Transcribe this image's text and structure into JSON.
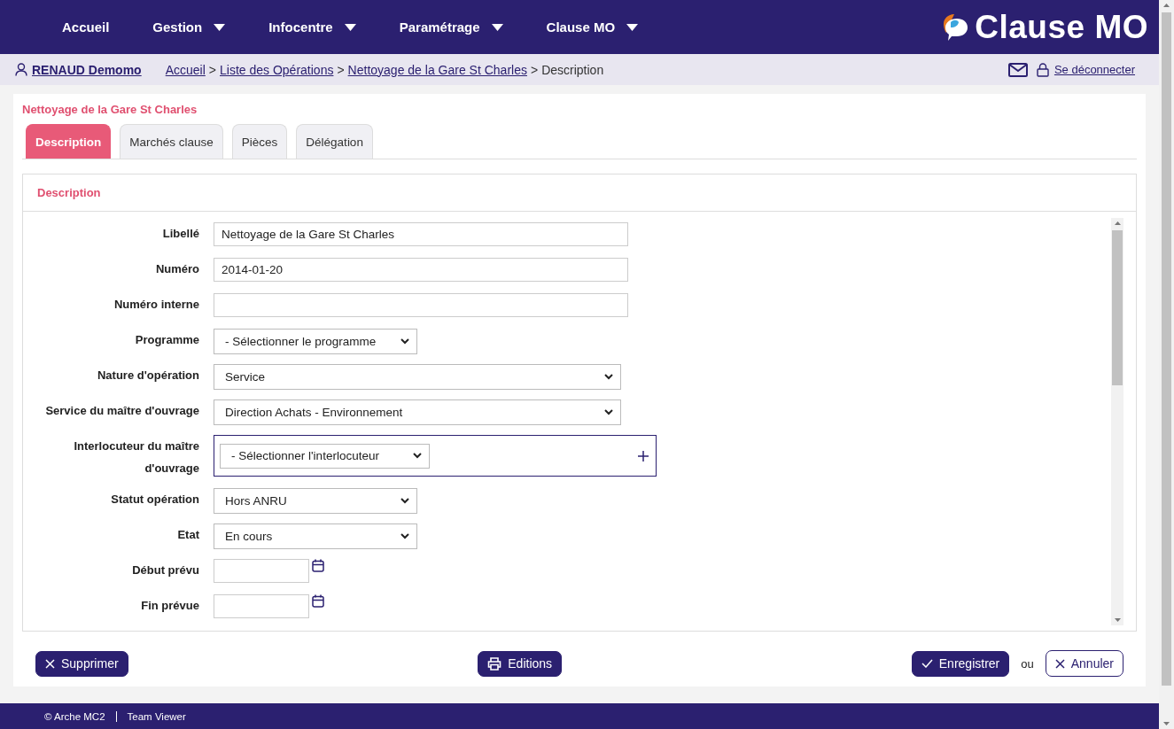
{
  "nav": [
    {
      "label": "Accueil",
      "dropdown": false
    },
    {
      "label": "Gestion",
      "dropdown": true
    },
    {
      "label": "Infocentre",
      "dropdown": true
    },
    {
      "label": "Paramétrage",
      "dropdown": true
    },
    {
      "label": "Clause MO",
      "dropdown": true
    }
  ],
  "logo": "Clause MO",
  "user": "RENAUD Demomo",
  "breadcrumb": [
    {
      "label": "Accueil",
      "link": true
    },
    {
      "label": "Liste des Opérations",
      "link": true
    },
    {
      "label": "Nettoyage de la Gare St Charles",
      "link": true
    },
    {
      "label": "Description",
      "link": false
    }
  ],
  "breadcrumb_separator": ">",
  "logout": "Se déconnecter",
  "page_title": "Nettoyage de la Gare St Charles",
  "tabs": [
    {
      "label": "Description",
      "selected": true
    },
    {
      "label": "Marchés clause",
      "selected": false
    },
    {
      "label": "Pièces",
      "selected": false
    },
    {
      "label": "Délégation",
      "selected": false
    }
  ],
  "panel_title": "Description",
  "fields": [
    {
      "label": "Libellé",
      "kind": "text",
      "value": "Nettoyage de la Gare St Charles"
    },
    {
      "label": "Numéro",
      "kind": "text",
      "value": "2014-01-20"
    },
    {
      "label": "Numéro interne",
      "kind": "text"
    },
    {
      "label": "Programme",
      "kind": "select",
      "value": "- Sélectionner le programme"
    },
    {
      "label": "Nature d'opération",
      "kind": "wide-select",
      "value": "Service"
    },
    {
      "label": "Service du maître d'ouvrage",
      "kind": "wide-select",
      "value": "Direction Achats - Environnement"
    },
    {
      "label": "Interlocuteur du maître d'ouvrage",
      "kind": "contact",
      "value": "- Sélectionner l'interlocuteur"
    },
    {
      "label": "Statut opération",
      "kind": "select",
      "value": "Hors ANRU"
    },
    {
      "label": "Etat",
      "kind": "select",
      "value": "En cours"
    },
    {
      "label": "Début prévu",
      "kind": "date"
    },
    {
      "label": "Fin prévue",
      "kind": "date"
    }
  ],
  "buttons": {
    "delete": "Supprimer",
    "print": "Editions",
    "save": "Enregistrer",
    "or": "ou",
    "cancel": "Annuler"
  },
  "footer": [
    "© Arche MC2",
    "Team Viewer"
  ]
}
